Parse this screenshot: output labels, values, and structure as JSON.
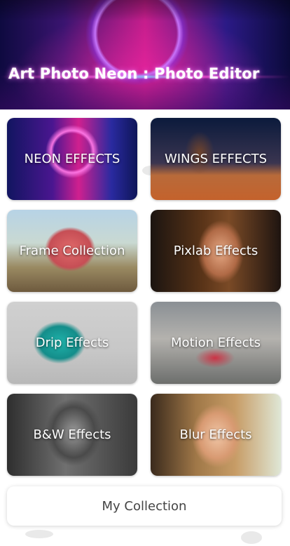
{
  "header": {
    "title": "Art Photo Neon : Photo Editor"
  },
  "tiles": [
    {
      "label": "NEON EFFECTS"
    },
    {
      "label": "WINGS EFFECTS"
    },
    {
      "label": "Frame Collection"
    },
    {
      "label": "Pixlab Effects"
    },
    {
      "label": "Drip Effects"
    },
    {
      "label": "Motion Effects"
    },
    {
      "label": "B&W Effects"
    },
    {
      "label": "Blur Effects"
    }
  ],
  "footer": {
    "collection_label": "My Collection"
  },
  "colors": {
    "background": "#ffffff",
    "header_pink": "#c21d8a",
    "header_blue": "#0e0a40"
  }
}
